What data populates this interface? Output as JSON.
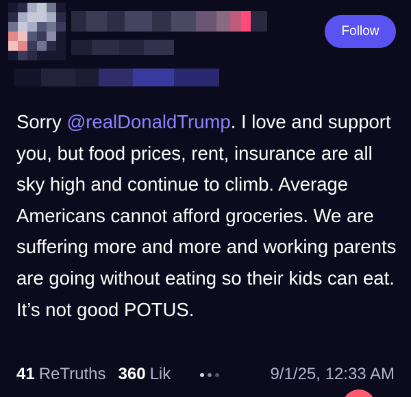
{
  "post": {
    "follow_label": "Follow",
    "body": {
      "prefix": "Sorry ",
      "mention": "@realDonaldTrump",
      "text": ". I love and support you, but food prices, rent, insurance are all sky high and continue to climb. Average Americans cannot afford groceries. We are suffering more and more and working parents are going without eating so their kids can eat. It’s not good POTUS."
    },
    "stats": {
      "retruths_count": "41",
      "retruths_label": "ReTruths",
      "likes_count": "360",
      "likes_label": "Lik"
    },
    "timestamp": "9/1/25, 12:33 AM"
  },
  "colors": {
    "background": "#0c0b1e",
    "accent": "#5b52f2",
    "mention": "#8b83ff",
    "muted_text": "#b5b3c9"
  },
  "icons": {
    "overflow": "more-dots-icon"
  }
}
